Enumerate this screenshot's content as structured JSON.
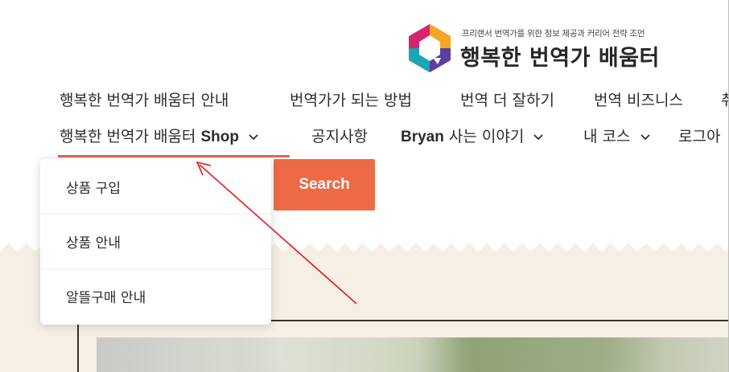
{
  "logo": {
    "tagline": "프리랜서 번역가를 위한 정보 제공과 커리어 전략 조언",
    "name": "행복한 번역가 배움터",
    "icon": "logo-hexagon-icon",
    "colors": [
      "#d6246e",
      "#f5a623",
      "#1aa6b7",
      "#2e7d32"
    ]
  },
  "nav": {
    "row1": [
      {
        "label": "행복한 번역가 배움터 안내"
      },
      {
        "label": "번역가가 되는 방법"
      },
      {
        "label": "번역 더 잘하기"
      },
      {
        "label": "번역 비즈니스"
      },
      {
        "label": "취"
      }
    ],
    "row2": {
      "shop": {
        "label": "행복한 번역가 배움터 ",
        "label_bold": "Shop"
      },
      "notice": {
        "label": "공지사항"
      },
      "bryan": {
        "label_bold": "Bryan",
        "label": " 사는 이야기"
      },
      "courses": {
        "label": "내 코스"
      },
      "login": {
        "label": "로그아"
      }
    }
  },
  "search": {
    "label": "Search"
  },
  "dropdown": {
    "items": [
      {
        "label": "상품 구입"
      },
      {
        "label": "상품 안내"
      },
      {
        "label": "알뜰구매 안내"
      }
    ]
  },
  "colors": {
    "accent": "#ee6a47",
    "underline": "#e0674a",
    "annotation": "#e31b1b",
    "band": "#f5efe6"
  }
}
